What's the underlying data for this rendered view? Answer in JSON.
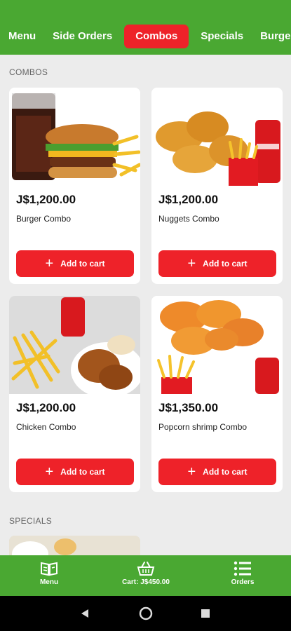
{
  "tabs": [
    {
      "label": "Menu"
    },
    {
      "label": "Side Orders"
    },
    {
      "label": "Combos",
      "active": true
    },
    {
      "label": "Specials"
    },
    {
      "label": "Burge"
    }
  ],
  "sections": {
    "combos": "COMBOS",
    "specials": "SPECIALS"
  },
  "products": [
    {
      "price": "J$1,200.00",
      "name": "Burger Combo",
      "button": "Add to cart"
    },
    {
      "price": "J$1,200.00",
      "name": "Nuggets Combo",
      "button": "Add to cart"
    },
    {
      "price": "J$1,200.00",
      "name": "Chicken Combo",
      "button": "Add to cart"
    },
    {
      "price": "J$1,350.00",
      "name": "Popcorn shrimp Combo",
      "button": "Add to cart"
    }
  ],
  "bottom_nav": {
    "menu": "Menu",
    "cart": "Cart: J$450.00",
    "orders": "Orders"
  },
  "colors": {
    "brand_green": "#4aa832",
    "accent_red": "#ee2229"
  }
}
